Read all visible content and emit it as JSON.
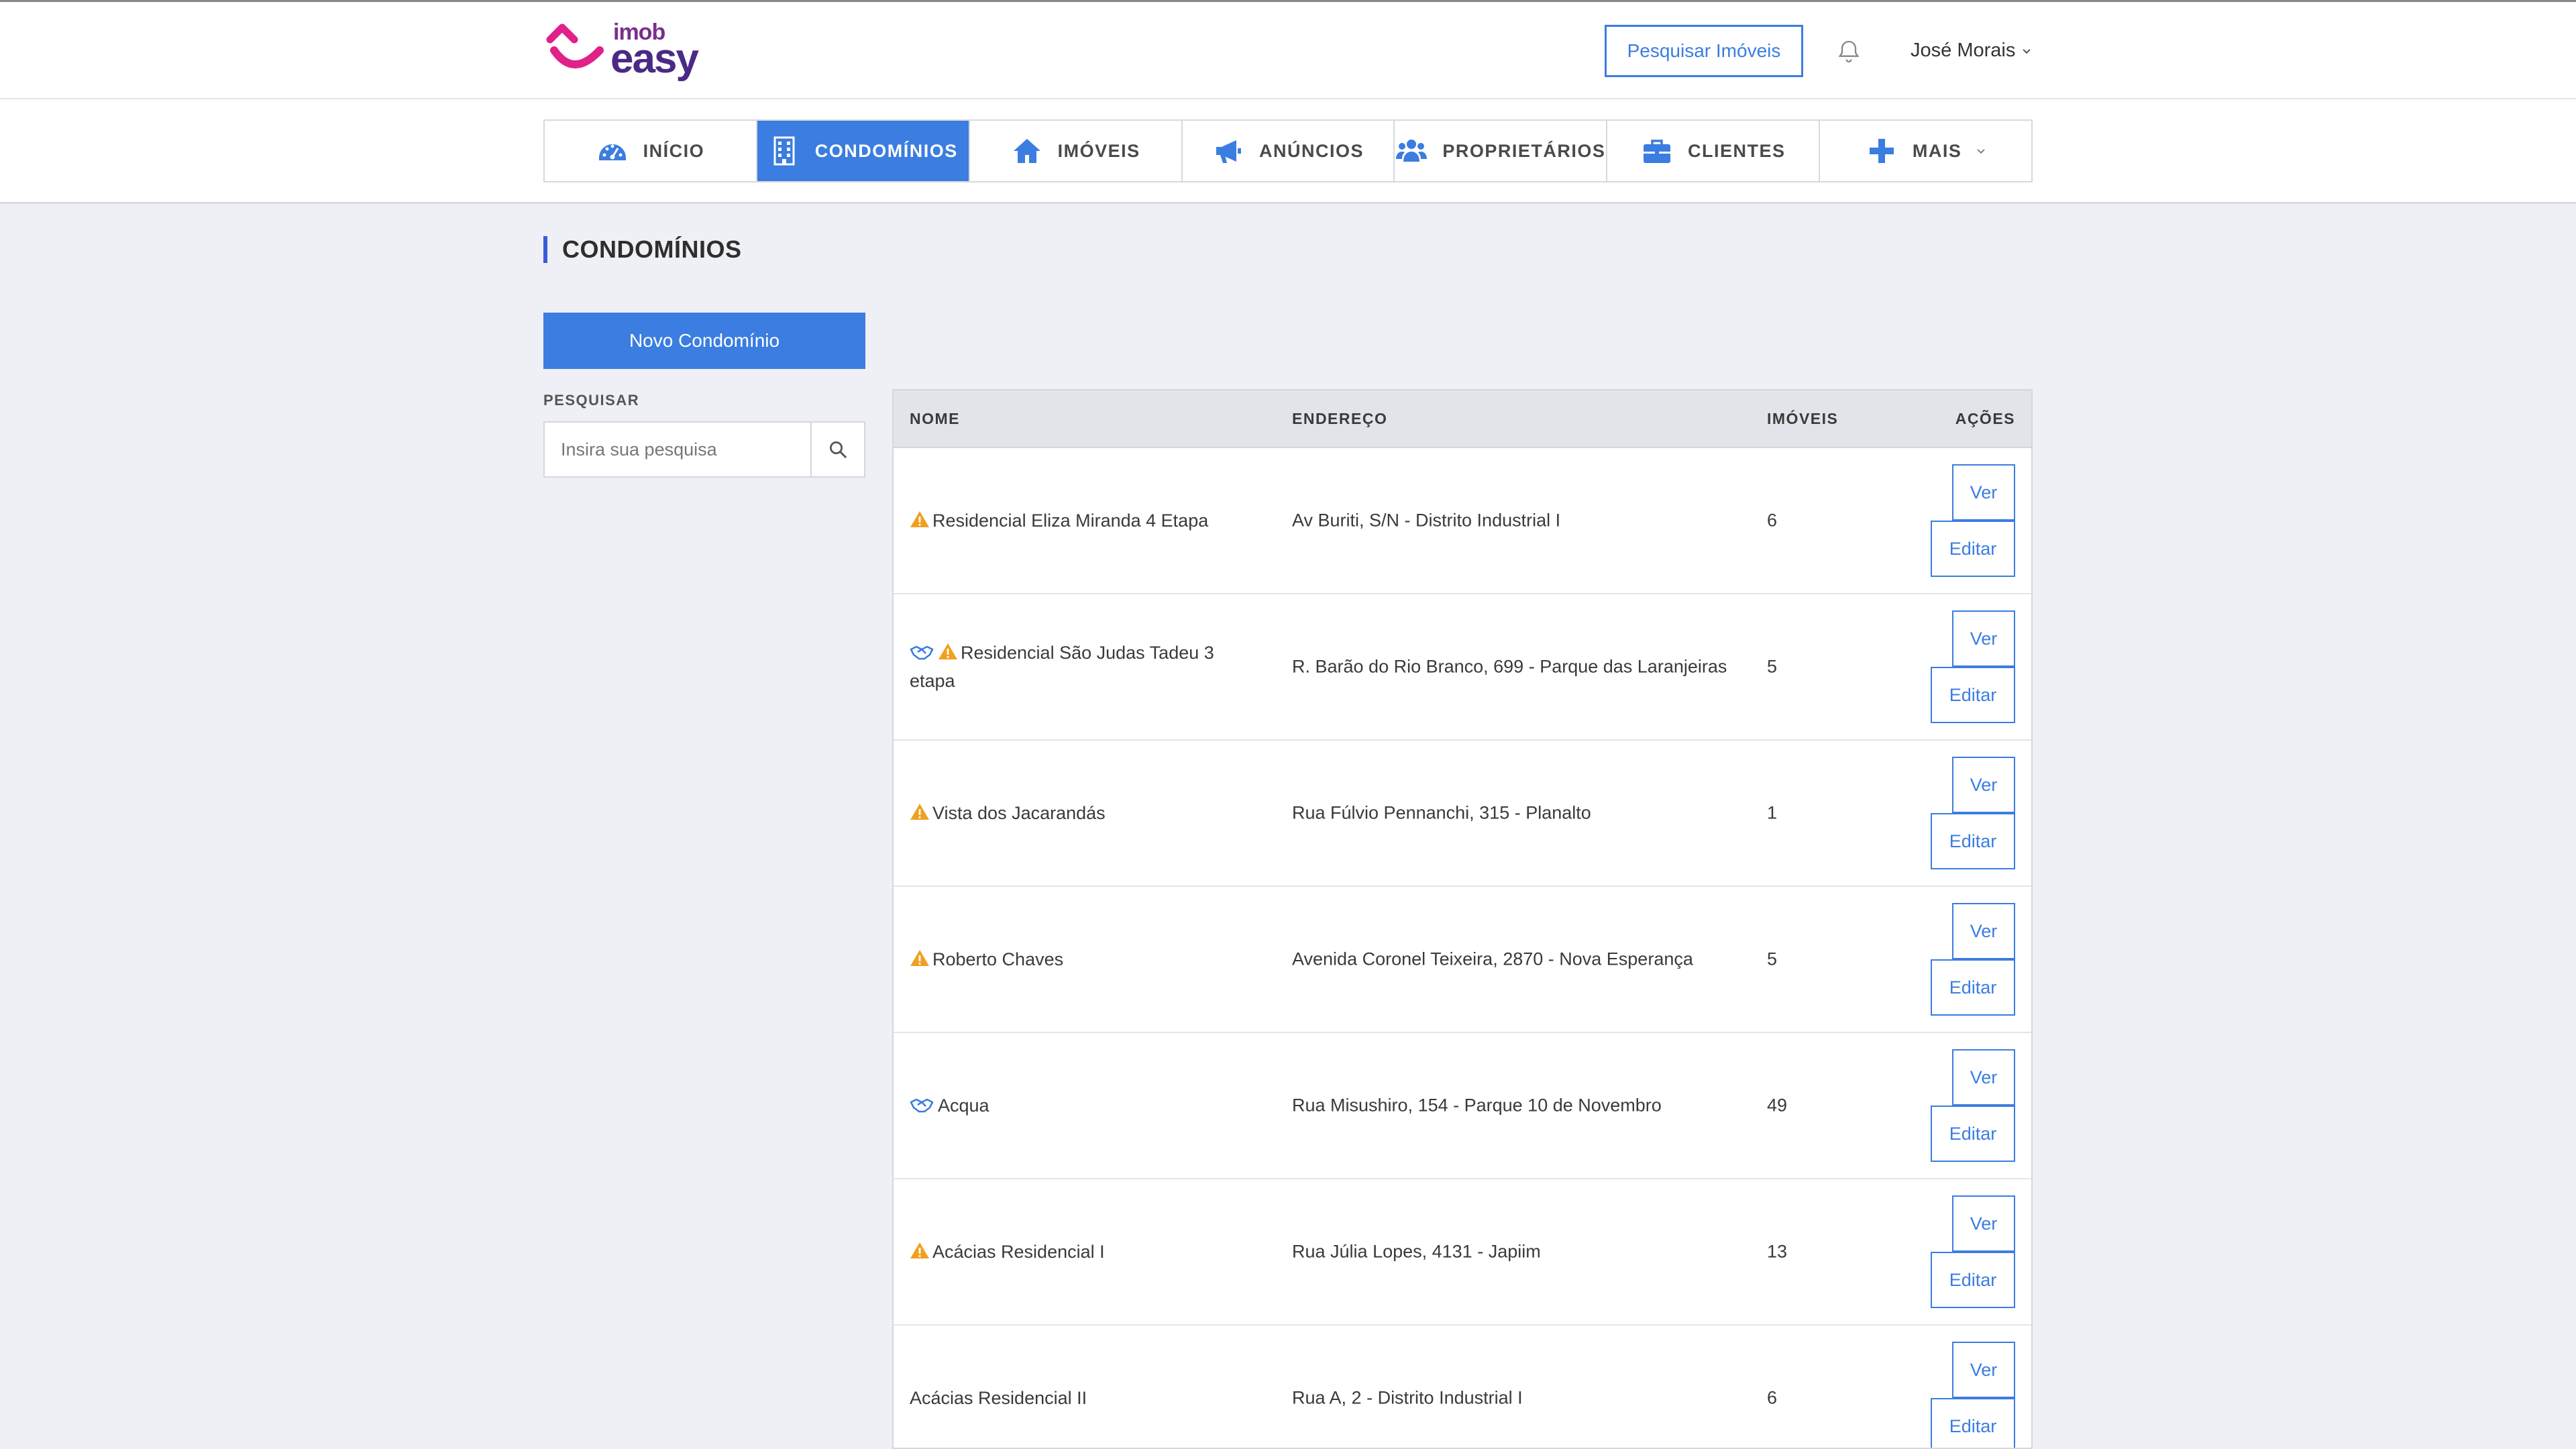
{
  "header": {
    "logo_top": "imob",
    "logo_bottom": "easy",
    "search_button": "Pesquisar Imóveis",
    "user_name": "José Morais"
  },
  "nav": {
    "items": [
      {
        "label": "INÍCIO",
        "icon": "dashboard-icon"
      },
      {
        "label": "CONDOMÍNIOS",
        "icon": "building-icon",
        "active": true
      },
      {
        "label": "IMÓVEIS",
        "icon": "home-icon"
      },
      {
        "label": "ANÚNCIOS",
        "icon": "megaphone-icon"
      },
      {
        "label": "PROPRIETÁRIOS",
        "icon": "users-icon"
      },
      {
        "label": "CLIENTES",
        "icon": "briefcase-icon"
      },
      {
        "label": "MAIS",
        "icon": "plus-icon"
      }
    ]
  },
  "page": {
    "title": "CONDOMÍNIOS",
    "new_button": "Novo Condomínio",
    "search_label": "PESQUISAR",
    "search_placeholder": "Insira sua pesquisa"
  },
  "table": {
    "headers": {
      "nome": "NOME",
      "endereco": "ENDEREÇO",
      "imoveis": "IMÓVEIS",
      "acoes": "AÇÕES"
    },
    "ver_label": "Ver",
    "edit_label": "Editar",
    "rows": [
      {
        "nome": "Residencial Eliza Miranda 4 Etapa",
        "endereco": "Av Buriti, S/N - Distrito Industrial I",
        "imoveis": "6",
        "warn": true,
        "hand": false
      },
      {
        "nome": "Residencial São Judas Tadeu 3 etapa",
        "endereco": "R. Barão do Rio Branco, 699 - Parque das Laranjeiras",
        "imoveis": "5",
        "warn": true,
        "hand": true
      },
      {
        "nome": "Vista dos Jacarandás",
        "endereco": "Rua Fúlvio Pennanchi, 315 - Planalto",
        "imoveis": "1",
        "warn": true,
        "hand": false
      },
      {
        "nome": "Roberto Chaves",
        "endereco": "Avenida Coronel Teixeira, 2870 - Nova Esperança",
        "imoveis": "5",
        "warn": true,
        "hand": false
      },
      {
        "nome": "Acqua",
        "endereco": "Rua Misushiro, 154 - Parque 10 de Novembro",
        "imoveis": "49",
        "warn": false,
        "hand": true
      },
      {
        "nome": "Acácias Residencial I",
        "endereco": "Rua Júlia Lopes, 4131 - Japiim",
        "imoveis": "13",
        "warn": true,
        "hand": false
      },
      {
        "nome": "Acácias Residencial II",
        "endereco": "Rua A, 2 - Distrito Industrial I",
        "imoveis": "6",
        "warn": false,
        "hand": false
      }
    ]
  },
  "colors": {
    "accent": "#3b7de0",
    "warning": "#f0a020",
    "logo_pink": "#e0218a",
    "logo_purple": "#4a2a85"
  }
}
